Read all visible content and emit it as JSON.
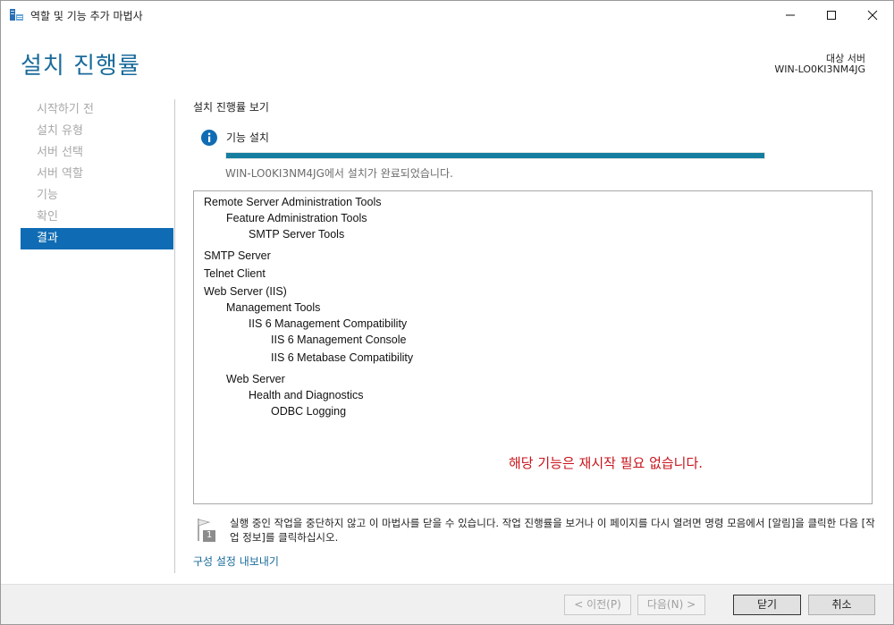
{
  "window": {
    "title": "역할 및 기능 추가 마법사"
  },
  "header": {
    "page_title": "설치 진행률",
    "target_label": "대상 서버",
    "target_name": "WIN-LO0KI3NM4JG"
  },
  "nav": {
    "items": [
      {
        "label": "시작하기 전"
      },
      {
        "label": "설치 유형"
      },
      {
        "label": "서버 선택"
      },
      {
        "label": "서버 역할"
      },
      {
        "label": "기능"
      },
      {
        "label": "확인"
      },
      {
        "label": "결과"
      }
    ],
    "active_index": 6
  },
  "main": {
    "section_title": "설치 진행률 보기",
    "info_label": "기능 설치",
    "progress_fraction": 1.0,
    "status_text": "WIN-LO0KI3NM4JG에서 설치가 완료되었습니다.",
    "results": [
      {
        "text": "Remote Server Administration Tools",
        "level": 0
      },
      {
        "text": "Feature Administration Tools",
        "level": 1
      },
      {
        "text": "SMTP Server Tools",
        "level": 2
      },
      {
        "text": "SMTP Server",
        "level": 0
      },
      {
        "text": "Telnet Client",
        "level": 0
      },
      {
        "text": "Web Server (IIS)",
        "level": 0
      },
      {
        "text": "Management Tools",
        "level": 1
      },
      {
        "text": "IIS 6 Management Compatibility",
        "level": 2
      },
      {
        "text": "IIS 6 Management Console",
        "level": 3
      },
      {
        "text": "IIS 6 Metabase Compatibility",
        "level": 3
      },
      {
        "text": "Web Server",
        "level": 1
      },
      {
        "text": "Health and Diagnostics",
        "level": 2
      },
      {
        "text": "ODBC Logging",
        "level": 3
      }
    ],
    "restart_note": "해당 기능은 재시작 필요 없습니다.",
    "note_text": "실행 중인 작업을 중단하지 않고 이 마법사를 닫을 수 있습니다. 작업 진행률을 보거나 이 페이지를 다시 열려면 명령 모음에서 [알림]을 클릭한 다음 [작업 정보]를 클릭하십시오.",
    "note_badge": "1",
    "export_link": "구성 설정 내보내기"
  },
  "footer": {
    "prev_label": "< 이전(P)",
    "next_label": "다음(N) >",
    "close_label": "닫기",
    "cancel_label": "취소"
  },
  "colors": {
    "title_blue": "#1a6b9b",
    "nav_active": "#0f6cb4",
    "progress": "#157ea0",
    "restart_note": "#c8141c"
  }
}
